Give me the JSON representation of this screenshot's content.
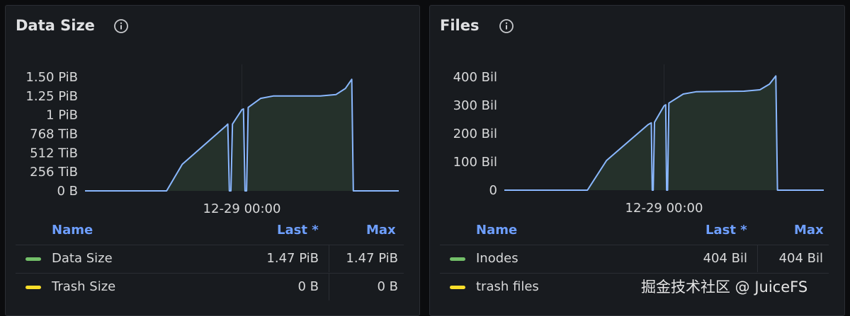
{
  "panels": [
    {
      "title": "Data Size",
      "legend": {
        "headers": {
          "name": "Name",
          "last": "Last *",
          "max": "Max"
        },
        "rows": [
          {
            "name": "Data Size",
            "last": "1.47 PiB",
            "max": "1.47 PiB",
            "color": "#73bf69"
          },
          {
            "name": "Trash Size",
            "last": "0 B",
            "max": "0 B",
            "color": "#fade2a"
          }
        ]
      }
    },
    {
      "title": "Files",
      "legend": {
        "headers": {
          "name": "Name",
          "last": "Last *",
          "max": "Max"
        },
        "rows": [
          {
            "name": "Inodes",
            "last": "404 Bil",
            "max": "404 Bil",
            "color": "#73bf69"
          },
          {
            "name": "trash files",
            "last": "",
            "max": "",
            "color": "#fade2a"
          }
        ]
      }
    }
  ],
  "chart_data": [
    {
      "type": "area",
      "yticks": [
        "1.50 PiB",
        "1.25 PiB",
        "1 PiB",
        "768 TiB",
        "512 TiB",
        "256 TiB",
        "0 B"
      ],
      "ytick_values": [
        1.5,
        1.25,
        1.0,
        0.75,
        0.5,
        0.25,
        0
      ],
      "ylim": [
        0,
        1.5
      ],
      "xticks": [
        "12-29 00:00"
      ],
      "xtick_positions": [
        0.5
      ],
      "series_color": "#8ab8ff",
      "x": [
        0,
        0.26,
        0.31,
        0.45,
        0.455,
        0.46,
        0.465,
        0.47,
        0.5,
        0.505,
        0.51,
        0.515,
        0.52,
        0.56,
        0.6,
        0.75,
        0.8,
        0.83,
        0.85,
        0.855,
        0.86,
        1.0
      ],
      "values": [
        0,
        0,
        0.35,
        0.86,
        0.88,
        0,
        0,
        0.88,
        1.07,
        1.08,
        0,
        0,
        1.1,
        1.22,
        1.25,
        1.25,
        1.27,
        1.35,
        1.47,
        0,
        0,
        0
      ]
    },
    {
      "type": "area",
      "yticks": [
        "400 Bil",
        "300 Bil",
        "200 Bil",
        "100 Bil",
        "0"
      ],
      "ytick_values": [
        400,
        300,
        200,
        100,
        0
      ],
      "ylim": [
        0,
        400
      ],
      "xticks": [
        "12-29 00:00"
      ],
      "xtick_positions": [
        0.5
      ],
      "series_color": "#8ab8ff",
      "x": [
        0,
        0.26,
        0.32,
        0.45,
        0.46,
        0.463,
        0.466,
        0.47,
        0.5,
        0.505,
        0.508,
        0.511,
        0.515,
        0.56,
        0.6,
        0.75,
        0.8,
        0.83,
        0.85,
        0.855,
        0.86,
        1.0
      ],
      "values": [
        0,
        0,
        105,
        232,
        238,
        0,
        0,
        240,
        298,
        302,
        0,
        0,
        308,
        340,
        348,
        350,
        355,
        375,
        404,
        0,
        0,
        0
      ]
    }
  ],
  "watermark": "掘金技术社区 @ JuiceFS"
}
